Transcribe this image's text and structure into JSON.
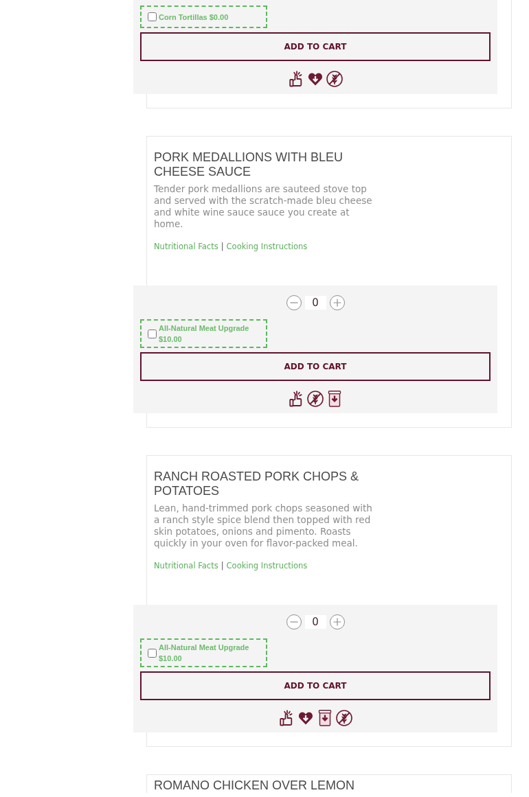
{
  "products": [
    {
      "options": [
        {
          "label": "Corn Tortillas $0.00",
          "checked": false
        }
      ],
      "add_to_cart": "ADD TO CART",
      "badges": [
        {
          "kind": "thumbs-up"
        },
        {
          "kind": "heart"
        },
        {
          "kind": "no-wheat"
        }
      ]
    },
    {
      "title": "PORK MEDALLIONS WITH BLEU CHEESE SAUCE",
      "description": "Tender pork medallions are sauteed stove top and served with the scratch-made bleu cheese and white wine sauce sauce you create at home.",
      "links": [
        "Nutritional Facts",
        "Cooking Instructions"
      ],
      "link_separator": "|",
      "quantity": "0",
      "options": [
        {
          "label": "All-Natural Meat Upgrade $10.00",
          "checked": false
        }
      ],
      "add_to_cart": "ADD TO CART",
      "badges": [
        {
          "kind": "thumbs-up"
        },
        {
          "kind": "no-wheat"
        },
        {
          "kind": "jar"
        }
      ]
    },
    {
      "title": "RANCH ROASTED PORK CHOPS & POTATOES",
      "description": "Lean, hand-trimmed pork chops seasoned with a ranch style spice blend then topped with red skin potatoes, onions and pimento. Roasts quickly in your oven for flavor-packed meal.",
      "links": [
        "Nutritional Facts",
        "Cooking Instructions"
      ],
      "link_separator": "|",
      "quantity": "0",
      "options": [
        {
          "label": "All-Natural Meat Upgrade $10.00",
          "checked": false
        }
      ],
      "add_to_cart": "ADD TO CART",
      "badges": [
        {
          "kind": "thumbs-up"
        },
        {
          "kind": "heart"
        },
        {
          "kind": "jar"
        },
        {
          "kind": "no-wheat"
        }
      ]
    },
    {
      "title": "ROMANO CHICKEN OVER LEMON"
    }
  ]
}
